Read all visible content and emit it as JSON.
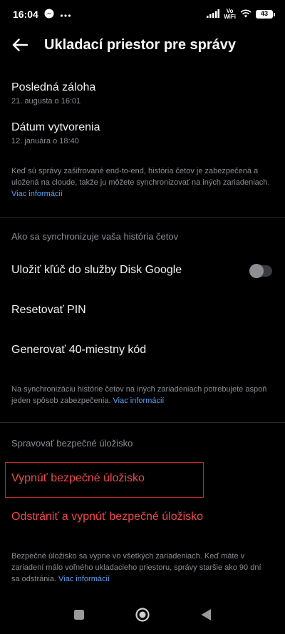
{
  "status_bar": {
    "time": "16:04",
    "vowifi_top": "Vo",
    "vowifi_bottom": "WiFi",
    "battery": "43"
  },
  "header": {
    "title": "Ukladací priestor pre správy"
  },
  "backup": {
    "last_backup_label": "Posledná záloha",
    "last_backup_value": "21. augusta o 16:01",
    "created_label": "Dátum vytvorenia",
    "created_value": "12. januára o 18:40",
    "description": "Keď sú správy zašifrované end-to-end, história četov je zabezpečená a uložená na cloude, takže ju môžete synchronizovať na iných zariadeniach.",
    "more_info": "Viac informácií"
  },
  "sync": {
    "section_title": "Ako sa synchronizuje vaša história četov",
    "google_drive_label": "Uložiť kľúč do služby Disk Google",
    "google_drive_enabled": false,
    "reset_pin_label": "Resetovať PIN",
    "generate_code_label": "Generovať 40-miestny kód",
    "description": "Na synchronizáciu histórie četov na iných zariadeniach potrebujete aspoň jeden spôsob zabezpečenia.",
    "more_info": "Viac informácií"
  },
  "manage": {
    "section_title": "Spravovať bezpečné úložisko",
    "turn_off_label": "Vypnúť bezpečné úložisko",
    "delete_label": "Odstrániť a vypnúť bezpečné úložisko",
    "description": "Bezpečné úložisko sa vypne vo všetkých zariadeniach. Keď máte v zariadení málo voľného ukladacieho priestoru, správy staršie ako 90 dní sa odstránia.",
    "more_info": "Viac informácií"
  },
  "colors": {
    "accent_link": "#5aa2f5",
    "danger": "#f0484f"
  }
}
